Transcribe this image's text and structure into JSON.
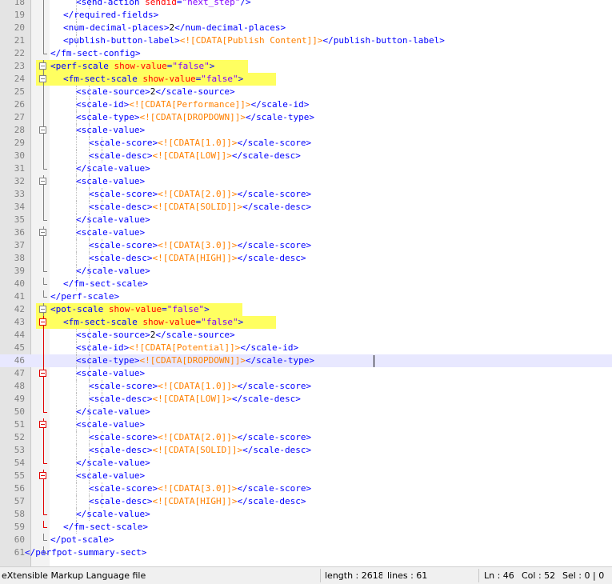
{
  "editor": {
    "current_line": 46,
    "lines": [
      {
        "n": "18",
        "fold": "line",
        "indent": 4,
        "tokens": [
          [
            "tag",
            "<send-action "
          ],
          [
            "attr",
            "sendid"
          ],
          [
            "tag",
            "="
          ],
          [
            "val",
            "\"next_step\""
          ],
          [
            "tag",
            "/>"
          ]
        ]
      },
      {
        "n": "19",
        "fold": "line",
        "indent": 3,
        "tokens": [
          [
            "tag",
            "</required-fields>"
          ]
        ]
      },
      {
        "n": "20",
        "fold": "line",
        "indent": 3,
        "tokens": [
          [
            "tag",
            "<num-decimal-places>"
          ],
          [
            "text",
            "2"
          ],
          [
            "tag",
            "</num-decimal-places>"
          ]
        ]
      },
      {
        "n": "21",
        "fold": "line",
        "indent": 3,
        "tokens": [
          [
            "tag",
            "<publish-button-label>"
          ],
          [
            "cdata",
            "<![CDATA[Publish Content]]>"
          ],
          [
            "tag",
            "</publish-button-label>"
          ]
        ]
      },
      {
        "n": "22",
        "fold": "end",
        "indent": 2,
        "tokens": [
          [
            "tag",
            "</fm-sect-config>"
          ]
        ]
      },
      {
        "n": "23",
        "fold": "box",
        "indent": 2,
        "highlight": true,
        "tokens": [
          [
            "tag",
            "<perf-scale "
          ],
          [
            "attr",
            "show-value"
          ],
          [
            "tag",
            "="
          ],
          [
            "val",
            "\"false\""
          ],
          [
            "tag",
            ">"
          ]
        ]
      },
      {
        "n": "24",
        "fold": "box",
        "indent": 3,
        "highlight": true,
        "tokens": [
          [
            "tag",
            "<fm-sect-scale "
          ],
          [
            "attr",
            "show-value"
          ],
          [
            "tag",
            "="
          ],
          [
            "val",
            "\"false\""
          ],
          [
            "tag",
            ">"
          ]
        ]
      },
      {
        "n": "25",
        "fold": "line",
        "indent": 4,
        "tokens": [
          [
            "tag",
            "<scale-source>"
          ],
          [
            "text",
            "2"
          ],
          [
            "tag",
            "</scale-source>"
          ]
        ]
      },
      {
        "n": "26",
        "fold": "line",
        "indent": 4,
        "tokens": [
          [
            "tag",
            "<scale-id>"
          ],
          [
            "cdata",
            "<![CDATA[Performance]]>"
          ],
          [
            "tag",
            "</scale-id>"
          ]
        ]
      },
      {
        "n": "27",
        "fold": "line",
        "indent": 4,
        "tokens": [
          [
            "tag",
            "<scale-type>"
          ],
          [
            "cdata",
            "<![CDATA[DROPDOWN]]>"
          ],
          [
            "tag",
            "</scale-type>"
          ]
        ]
      },
      {
        "n": "28",
        "fold": "box",
        "indent": 4,
        "tokens": [
          [
            "tag",
            "<scale-value>"
          ]
        ]
      },
      {
        "n": "29",
        "fold": "line",
        "indent": 5,
        "tokens": [
          [
            "tag",
            "<scale-score>"
          ],
          [
            "cdata",
            "<![CDATA[1.0]]>"
          ],
          [
            "tag",
            "</scale-score>"
          ]
        ]
      },
      {
        "n": "30",
        "fold": "line",
        "indent": 5,
        "tokens": [
          [
            "tag",
            "<scale-desc>"
          ],
          [
            "cdata",
            "<![CDATA[LOW]]>"
          ],
          [
            "tag",
            "</scale-desc>"
          ]
        ]
      },
      {
        "n": "31",
        "fold": "end",
        "indent": 4,
        "tokens": [
          [
            "tag",
            "</scale-value>"
          ]
        ]
      },
      {
        "n": "32",
        "fold": "box",
        "indent": 4,
        "tokens": [
          [
            "tag",
            "<scale-value>"
          ]
        ]
      },
      {
        "n": "33",
        "fold": "line",
        "indent": 5,
        "tokens": [
          [
            "tag",
            "<scale-score>"
          ],
          [
            "cdata",
            "<![CDATA[2.0]]>"
          ],
          [
            "tag",
            "</scale-score>"
          ]
        ]
      },
      {
        "n": "34",
        "fold": "line",
        "indent": 5,
        "tokens": [
          [
            "tag",
            "<scale-desc>"
          ],
          [
            "cdata",
            "<![CDATA[SOLID]]>"
          ],
          [
            "tag",
            "</scale-desc>"
          ]
        ]
      },
      {
        "n": "35",
        "fold": "end",
        "indent": 4,
        "tokens": [
          [
            "tag",
            "</scale-value>"
          ]
        ]
      },
      {
        "n": "36",
        "fold": "box",
        "indent": 4,
        "tokens": [
          [
            "tag",
            "<scale-value>"
          ]
        ]
      },
      {
        "n": "37",
        "fold": "line",
        "indent": 5,
        "tokens": [
          [
            "tag",
            "<scale-score>"
          ],
          [
            "cdata",
            "<![CDATA[3.0]]>"
          ],
          [
            "tag",
            "</scale-score>"
          ]
        ]
      },
      {
        "n": "38",
        "fold": "line",
        "indent": 5,
        "tokens": [
          [
            "tag",
            "<scale-desc>"
          ],
          [
            "cdata",
            "<![CDATA[HIGH]]>"
          ],
          [
            "tag",
            "</scale-desc>"
          ]
        ]
      },
      {
        "n": "39",
        "fold": "end",
        "indent": 4,
        "tokens": [
          [
            "tag",
            "</scale-value>"
          ]
        ]
      },
      {
        "n": "40",
        "fold": "end",
        "indent": 3,
        "tokens": [
          [
            "tag",
            "</fm-sect-scale>"
          ]
        ]
      },
      {
        "n": "41",
        "fold": "end",
        "indent": 2,
        "tokens": [
          [
            "tag",
            "</perf-scale>"
          ]
        ]
      },
      {
        "n": "42",
        "fold": "box",
        "indent": 2,
        "highlight": true,
        "tokens": [
          [
            "tag",
            "<pot-scale "
          ],
          [
            "attr",
            "show-value"
          ],
          [
            "tag",
            "="
          ],
          [
            "val",
            "\"false\""
          ],
          [
            "tag",
            ">"
          ]
        ]
      },
      {
        "n": "43",
        "fold": "box-red",
        "indent": 3,
        "highlight": true,
        "tokens": [
          [
            "tag",
            "<fm-sect-scale "
          ],
          [
            "attr",
            "show-value"
          ],
          [
            "tag",
            "="
          ],
          [
            "val",
            "\"false\""
          ],
          [
            "tag",
            ">"
          ]
        ]
      },
      {
        "n": "44",
        "fold": "line-red",
        "indent": 4,
        "tokens": [
          [
            "tag",
            "<scale-source>"
          ],
          [
            "text",
            "2"
          ],
          [
            "tag",
            "</scale-source>"
          ]
        ]
      },
      {
        "n": "45",
        "fold": "line-red",
        "indent": 4,
        "tokens": [
          [
            "tag",
            "<scale-id>"
          ],
          [
            "cdata",
            "<![CDATA[Potential]]>"
          ],
          [
            "tag",
            "</scale-id>"
          ]
        ]
      },
      {
        "n": "46",
        "fold": "line-red",
        "indent": 4,
        "tokens": [
          [
            "tag",
            "<scale-type>"
          ],
          [
            "cdata",
            "<![CDATA[DROPDOWN]]>"
          ],
          [
            "tag",
            "</scale-type>"
          ]
        ]
      },
      {
        "n": "47",
        "fold": "box-red",
        "indent": 4,
        "tokens": [
          [
            "tag",
            "<scale-value>"
          ]
        ]
      },
      {
        "n": "48",
        "fold": "line-red",
        "indent": 5,
        "tokens": [
          [
            "tag",
            "<scale-score>"
          ],
          [
            "cdata",
            "<![CDATA[1.0]]>"
          ],
          [
            "tag",
            "</scale-score>"
          ]
        ]
      },
      {
        "n": "49",
        "fold": "line-red",
        "indent": 5,
        "tokens": [
          [
            "tag",
            "<scale-desc>"
          ],
          [
            "cdata",
            "<![CDATA[LOW]]>"
          ],
          [
            "tag",
            "</scale-desc>"
          ]
        ]
      },
      {
        "n": "50",
        "fold": "end-red",
        "indent": 4,
        "tokens": [
          [
            "tag",
            "</scale-value>"
          ]
        ]
      },
      {
        "n": "51",
        "fold": "box-red",
        "indent": 4,
        "tokens": [
          [
            "tag",
            "<scale-value>"
          ]
        ]
      },
      {
        "n": "52",
        "fold": "line-red",
        "indent": 5,
        "tokens": [
          [
            "tag",
            "<scale-score>"
          ],
          [
            "cdata",
            "<![CDATA[2.0]]>"
          ],
          [
            "tag",
            "</scale-score>"
          ]
        ]
      },
      {
        "n": "53",
        "fold": "line-red",
        "indent": 5,
        "tokens": [
          [
            "tag",
            "<scale-desc>"
          ],
          [
            "cdata",
            "<![CDATA[SOLID]]>"
          ],
          [
            "tag",
            "</scale-desc>"
          ]
        ]
      },
      {
        "n": "54",
        "fold": "end-red",
        "indent": 4,
        "tokens": [
          [
            "tag",
            "</scale-value>"
          ]
        ]
      },
      {
        "n": "55",
        "fold": "box-red",
        "indent": 4,
        "tokens": [
          [
            "tag",
            "<scale-value>"
          ]
        ]
      },
      {
        "n": "56",
        "fold": "line-red",
        "indent": 5,
        "tokens": [
          [
            "tag",
            "<scale-score>"
          ],
          [
            "cdata",
            "<![CDATA[3.0]]>"
          ],
          [
            "tag",
            "</scale-score>"
          ]
        ]
      },
      {
        "n": "57",
        "fold": "line-red",
        "indent": 5,
        "tokens": [
          [
            "tag",
            "<scale-desc>"
          ],
          [
            "cdata",
            "<![CDATA[HIGH]]>"
          ],
          [
            "tag",
            "</scale-desc>"
          ]
        ]
      },
      {
        "n": "58",
        "fold": "end-red",
        "indent": 4,
        "tokens": [
          [
            "tag",
            "</scale-value>"
          ]
        ]
      },
      {
        "n": "59",
        "fold": "end-red",
        "indent": 3,
        "tokens": [
          [
            "tag",
            "</fm-sect-scale>"
          ]
        ]
      },
      {
        "n": "60",
        "fold": "end",
        "indent": 2,
        "tokens": [
          [
            "tag",
            "</pot-scale>"
          ]
        ]
      },
      {
        "n": "61",
        "fold": "end",
        "indent": 0,
        "tokens": [
          [
            "tag",
            "</perfpot-summary-sect>"
          ]
        ]
      }
    ]
  },
  "status": {
    "file_type": "eXtensible Markup Language file",
    "length": "length : 2618",
    "lines": "lines : 61",
    "ln": "Ln : 46",
    "col": "Col : 52",
    "sel": "Sel : 0 | 0"
  },
  "colors": {
    "tag": "#0000ff",
    "attr": "#ff0000",
    "value": "#8000ff",
    "cdata": "#ff8000",
    "highlight": "#ffff60",
    "fold_active": "#e00000"
  }
}
